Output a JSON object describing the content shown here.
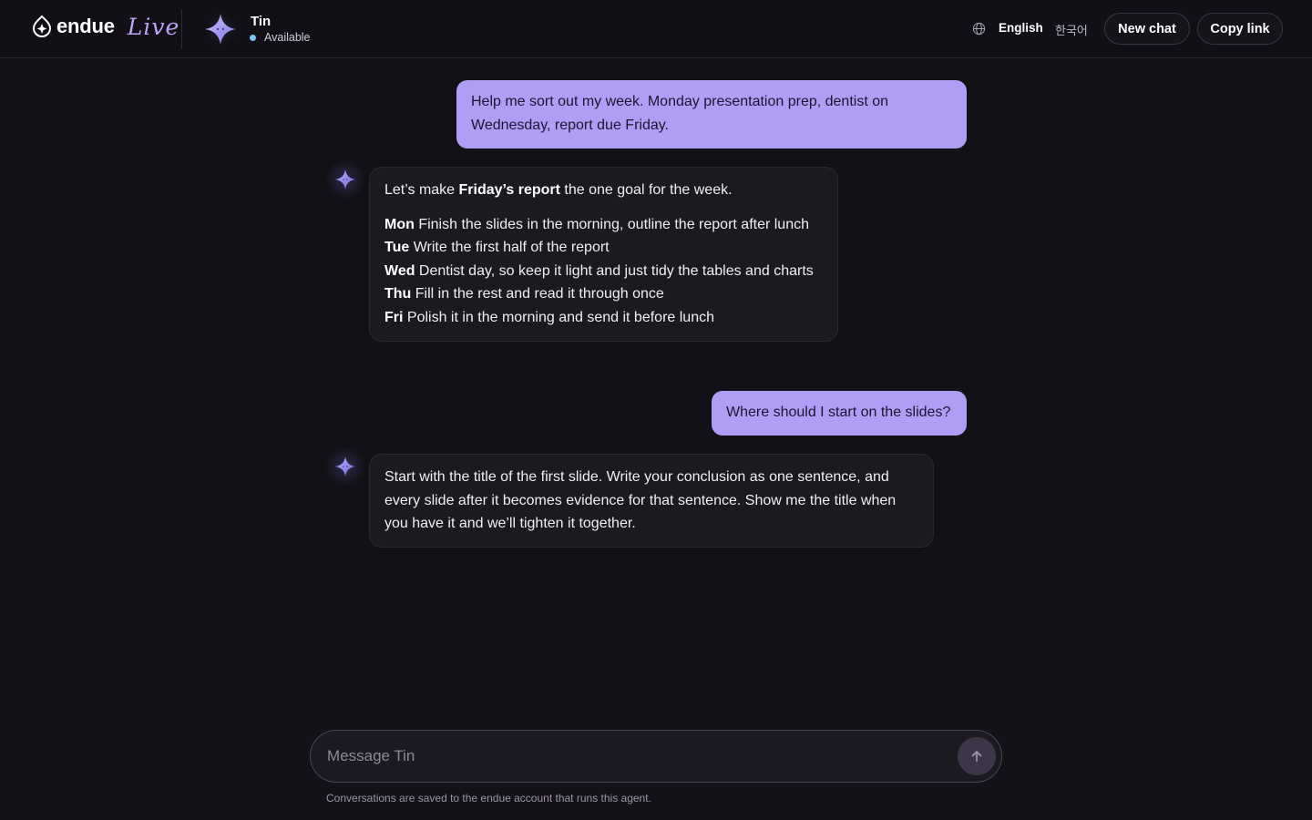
{
  "header": {
    "brand_name": "endue",
    "brand_live": "Live",
    "agent": {
      "name": "Tin",
      "status": "Available"
    },
    "lang_current": "English",
    "lang_alt": "한국어",
    "new_chat_label": "New chat",
    "copy_link_label": "Copy link"
  },
  "messages": [
    {
      "role": "user",
      "text": "Help me sort out my week. Monday presentation prep, dentist on Wednesday, report due Friday."
    },
    {
      "role": "assistant",
      "intro_pre": "Let’s make ",
      "intro_bold": "Friday’s report",
      "intro_post": " the one goal for the week.",
      "schedule": [
        {
          "day": "Mon",
          "task": " Finish the slides in the morning, outline the report after lunch"
        },
        {
          "day": "Tue",
          "task": " Write the first half of the report"
        },
        {
          "day": "Wed",
          "task": " Dentist day, so keep it light and just tidy the tables and charts"
        },
        {
          "day": "Thu",
          "task": " Fill in the rest and read it through once"
        },
        {
          "day": "Fri",
          "task": " Polish it in the morning and send it before lunch"
        }
      ]
    },
    {
      "role": "user",
      "text": "Where should I start on the slides?"
    },
    {
      "role": "assistant",
      "text": "Start with the title of the first slide. Write your conclusion as one sentence, and every slide after it becomes evidence for that sentence. Show me the title when you have it and we’ll tighten it together."
    }
  ],
  "composer": {
    "placeholder": "Message Tin",
    "value": "",
    "send_icon": "arrow-up-icon"
  },
  "footnote": "Conversations are saved to the endue account that runs this agent.",
  "colors": {
    "background": "#131118",
    "user_bubble": "#b09ef6",
    "assistant_bubble": "#1c1a21",
    "accent": "#b7a6f7",
    "status_dot": "#7cc6f2"
  }
}
